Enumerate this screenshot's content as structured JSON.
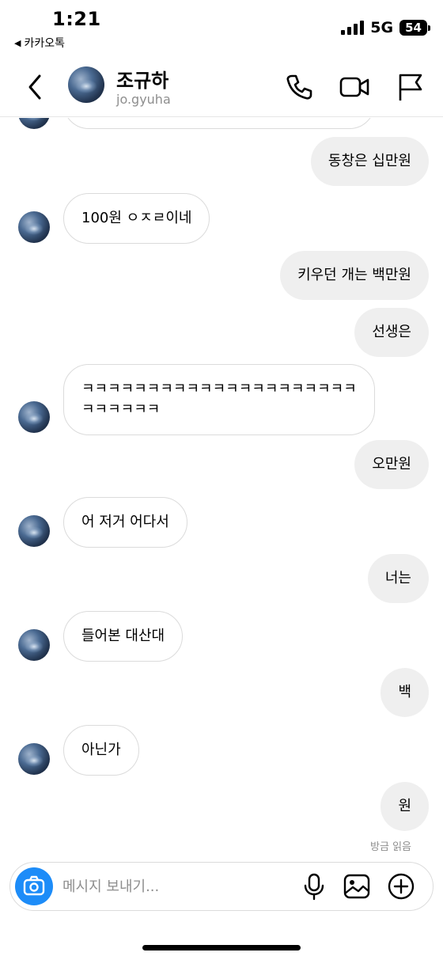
{
  "status_bar": {
    "time": "1:21",
    "back_app_label": "카카오톡",
    "network": "5G",
    "battery": "54"
  },
  "header": {
    "name": "조규하",
    "username": "jo.gyuha",
    "back_icon": "chevron-left-icon",
    "call_icon": "phone-icon",
    "video_icon": "video-camera-icon",
    "flag_icon": "flag-icon"
  },
  "messages": [
    {
      "direction": "out",
      "text": "동창은 십만원"
    },
    {
      "direction": "in",
      "text": "100원 ㅇㅈㄹ이네"
    },
    {
      "direction": "out",
      "text": "키우던 개는 백만원"
    },
    {
      "direction": "out",
      "text": "선생은"
    },
    {
      "direction": "in",
      "text": "ㅋㅋㅋㅋㅋㅋㅋㅋㅋㅋㅋㅋㅋㅋㅋㅋㅋㅋㅋㅋㅋㅋㅋㅋㅋㅋㅋ"
    },
    {
      "direction": "out",
      "text": "오만원"
    },
    {
      "direction": "in",
      "text": "어 저거 어다서"
    },
    {
      "direction": "out",
      "text": "너는"
    },
    {
      "direction": "in",
      "text": "들어본 대산대"
    },
    {
      "direction": "out",
      "text": "백"
    },
    {
      "direction": "in",
      "text": "아닌가"
    },
    {
      "direction": "out",
      "text": "원"
    }
  ],
  "read_receipt": "방금 읽음",
  "composer": {
    "placeholder": "메시지 보내기...",
    "value": "",
    "camera_icon": "camera-icon",
    "mic_icon": "microphone-icon",
    "gallery_icon": "image-icon",
    "plus_icon": "plus-circle-icon"
  },
  "colors": {
    "accent": "#1d8cf8",
    "outgoing_bubble": "#efefef",
    "incoming_border": "#dbdbdb",
    "secondary_text": "#8e8e8e"
  }
}
